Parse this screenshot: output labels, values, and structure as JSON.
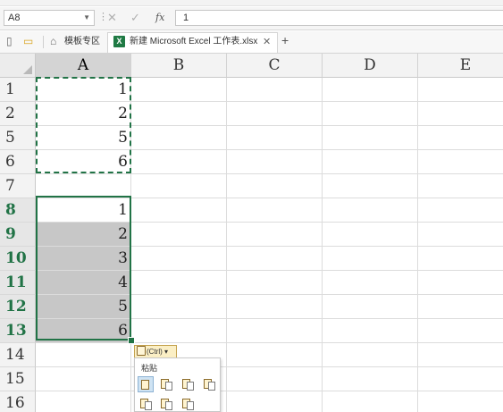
{
  "formula_bar": {
    "name_box": "A8",
    "cancel_glyph": "✕",
    "confirm_glyph": "✓",
    "fx_label": "fx",
    "formula_value": "1"
  },
  "tabs": {
    "template_tab_label": "模板专区",
    "workbook_tab_label": "新建 Microsoft Excel 工作表.xlsx",
    "close_glyph": "✕",
    "new_tab_glyph": "+"
  },
  "columns": [
    "A",
    "B",
    "C",
    "D",
    "E"
  ],
  "rows": [
    {
      "label": "1",
      "a": "1",
      "selected": false,
      "shaded": false
    },
    {
      "label": "2",
      "a": "2",
      "selected": false,
      "shaded": false
    },
    {
      "label": "5",
      "a": "5",
      "selected": false,
      "shaded": false
    },
    {
      "label": "6",
      "a": "6",
      "selected": false,
      "shaded": false
    },
    {
      "label": "7",
      "a": "",
      "selected": false,
      "shaded": false
    },
    {
      "label": "8",
      "a": "1",
      "selected": true,
      "shaded": false
    },
    {
      "label": "9",
      "a": "2",
      "selected": true,
      "shaded": true
    },
    {
      "label": "10",
      "a": "3",
      "selected": true,
      "shaded": true
    },
    {
      "label": "11",
      "a": "4",
      "selected": true,
      "shaded": true
    },
    {
      "label": "12",
      "a": "5",
      "selected": true,
      "shaded": true
    },
    {
      "label": "13",
      "a": "6",
      "selected": true,
      "shaded": true
    },
    {
      "label": "14",
      "a": "",
      "selected": false,
      "shaded": false
    },
    {
      "label": "15",
      "a": "",
      "selected": false,
      "shaded": false
    },
    {
      "label": "16",
      "a": "",
      "selected": false,
      "shaded": false
    }
  ],
  "paste_options": {
    "button_label": "(Ctrl)",
    "menu_title": "粘贴",
    "icons": [
      "paste-icon",
      "paste-formulas-icon",
      "paste-values-icon",
      "paste-formatting-icon",
      "paste-no-borders-icon",
      "paste-transpose-icon",
      "paste-link-icon"
    ]
  },
  "colors": {
    "selection_green": "#217346",
    "selected_fill": "#c7c7c7",
    "excel_icon": "#1f7a44"
  }
}
